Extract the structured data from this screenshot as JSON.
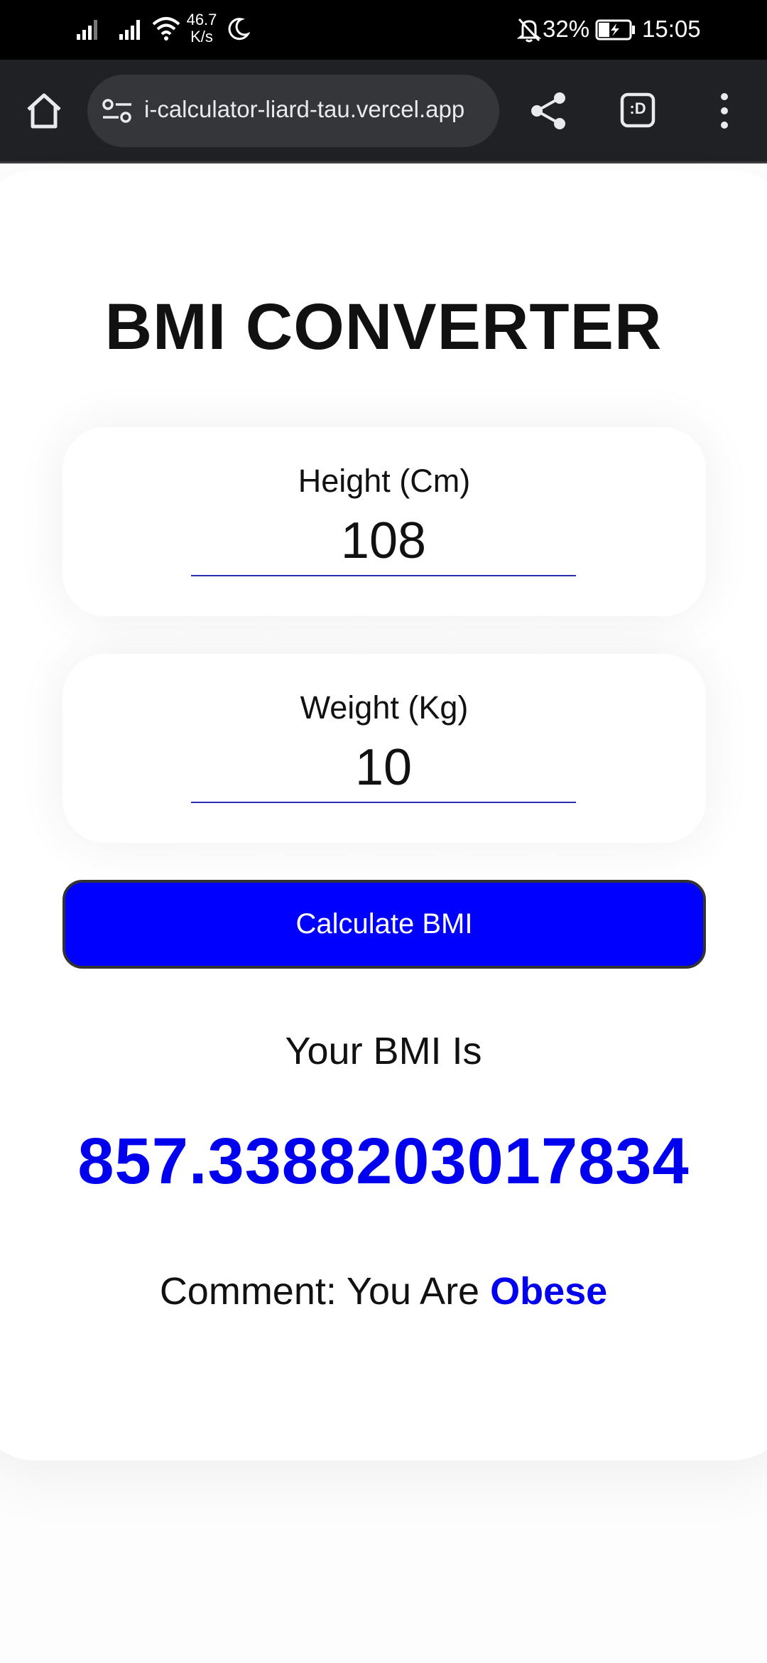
{
  "status_bar": {
    "net_speed_value": "46.7",
    "net_speed_unit": "K/s",
    "battery_percent": "32%",
    "time": "15:05"
  },
  "browser": {
    "url": "i-calculator-liard-tau.vercel.app",
    "tab_switcher_label": ":D"
  },
  "page": {
    "title": "BMI CONVERTER",
    "height": {
      "label": "Height (Cm)",
      "value": "108"
    },
    "weight": {
      "label": "Weight (Kg)",
      "value": "10"
    },
    "calculate_label": "Calculate BMI",
    "result_label": "Your BMI Is",
    "result_value": "857.3388203017834",
    "comment_prefix": "Comment: You Are ",
    "comment_status": "Obese"
  },
  "colors": {
    "accent": "#0000ff",
    "result_text": "#0000ee"
  }
}
